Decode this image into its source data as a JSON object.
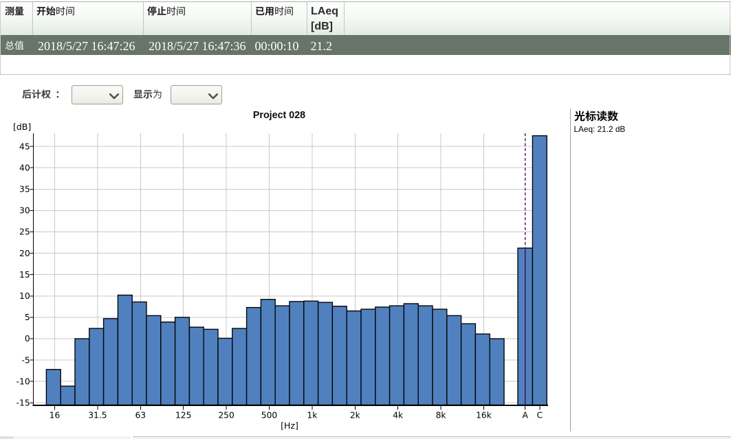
{
  "app": {
    "description": "sound level meter measurement report with 1/3-octave spectrum"
  },
  "table": {
    "headers": [
      {
        "text": "测量",
        "bold_part": "测量",
        "rest": ""
      },
      {
        "text": "开始时间",
        "bold_part": "开始",
        "rest": "时间"
      },
      {
        "text": "停止时间",
        "bold_part": "停止",
        "rest": "时间"
      },
      {
        "text": "已用时间",
        "bold_part": "已用",
        "rest": "时间"
      },
      {
        "text": "LAeq [dB]",
        "line1": "LAeq",
        "line2": "[dB]"
      }
    ],
    "row": {
      "measurement": "总值",
      "start_time": "2018/5/27 16:47:26",
      "stop_time": "2018/5/27 16:47:36",
      "elapsed_time": "00:00:10",
      "laeq_db": "21.2"
    }
  },
  "controls": {
    "post_weighting_label": "后计权 ：",
    "post_weighting_value": "",
    "display_as_label": "显示为",
    "display_as_value": ""
  },
  "cursor_panel": {
    "title": "光标读数",
    "reading": "LAeq: 21.2 dB"
  },
  "chart_data": {
    "type": "bar",
    "title": "Project 028",
    "ylabel": "[dB]",
    "xlabel": "[Hz]",
    "ylim": [
      -15,
      48
    ],
    "ytick_min": -15,
    "ytick_max": 45,
    "ytick_step": 5,
    "grid": true,
    "categories": [
      "16",
      "20",
      "25",
      "31.5",
      "40",
      "50",
      "63",
      "80",
      "100",
      "125",
      "160",
      "200",
      "250",
      "315",
      "400",
      "500",
      "630",
      "800",
      "1k",
      "1.25k",
      "1.6k",
      "2k",
      "2.5k",
      "3.15k",
      "4k",
      "5k",
      "6.3k",
      "8k",
      "10k",
      "12.5k",
      "16k",
      "20k"
    ],
    "values": [
      -7.2,
      -11.1,
      0.0,
      2.4,
      4.7,
      10.2,
      8.6,
      5.4,
      3.9,
      5.0,
      2.7,
      2.2,
      0.1,
      2.4,
      7.3,
      9.2,
      7.7,
      8.7,
      8.8,
      8.5,
      7.6,
      6.5,
      6.9,
      7.4,
      7.7,
      8.2,
      7.7,
      6.9,
      5.4,
      3.5,
      1.1,
      0.0
    ],
    "tick_every": 3,
    "xtick_labels": [
      "16",
      "31.5",
      "63",
      "125",
      "250",
      "500",
      "1k",
      "2k",
      "4k",
      "8k",
      "16k",
      "A",
      "C"
    ],
    "ytick_labels": [
      "45",
      "40",
      "35",
      "30",
      "25",
      "20",
      "15",
      "10",
      "5",
      "0",
      "-5",
      "-10",
      "-15"
    ],
    "extra_bars": [
      {
        "label": "A",
        "value": 21.2
      },
      {
        "label": "C",
        "value": 47.5
      }
    ],
    "cursor": {
      "on": "A",
      "value": 21.2
    },
    "legend": null
  },
  "colors": {
    "bar_fill": "#5081be",
    "bar_border": "#05050a",
    "cursor_line": "#4b1056",
    "grid_line": "#c9c9c9",
    "axis": "#000000",
    "row_bg": "#677469",
    "row_text": "#ffffff",
    "header_grad_top": "#fdfefd",
    "header_grad_bottom": "#e3eae3"
  }
}
